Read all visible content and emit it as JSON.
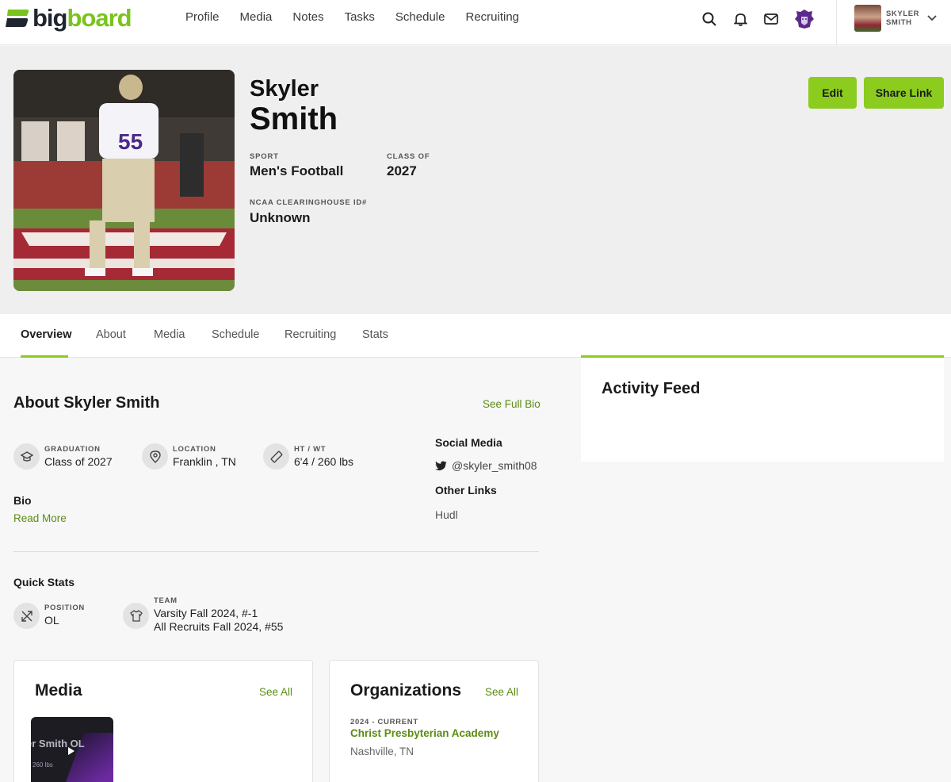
{
  "brand": {
    "logo_part1": "big",
    "logo_part2": "board",
    "accent": "#8bcc1f",
    "logo_icon": "bigboard-logo-mark"
  },
  "nav": {
    "links": [
      "Profile",
      "Media",
      "Notes",
      "Tasks",
      "Schedule",
      "Recruiting"
    ],
    "icons": [
      "search-icon",
      "bell-icon",
      "mail-icon",
      "lion-logo-icon"
    ],
    "user_name_line1": "SKYLER",
    "user_name_line2": "SMITH"
  },
  "profile": {
    "first_name": "Skyler",
    "last_name": "Smith",
    "sport_label": "SPORT",
    "sport": "Men's Football",
    "class_label": "CLASS OF",
    "class_of": "2027",
    "ncaa_label": "NCAA CLEARINGHOUSE ID#",
    "ncaa_id": "Unknown",
    "jersey_number": "55",
    "edit_label": "Edit",
    "share_label": "Share Link"
  },
  "tabs": [
    "Overview",
    "About",
    "Media",
    "Schedule",
    "Recruiting",
    "Stats"
  ],
  "about": {
    "title": "About Skyler Smith",
    "see_full_bio": "See Full Bio",
    "graduation_label": "GRADUATION",
    "graduation": "Class of 2027",
    "location_label": "LOCATION",
    "location": "Franklin , TN",
    "htwt_label": "HT / WT",
    "htwt": "6'4 / 260 lbs",
    "bio_label": "Bio",
    "read_more": "Read More",
    "social_label": "Social Media",
    "twitter": "@skyler_smith08",
    "other_links_label": "Other Links",
    "other_link": "Hudl"
  },
  "quick_stats": {
    "title": "Quick Stats",
    "position_label": "POSITION",
    "position": "OL",
    "team_label": "TEAM",
    "team_line1": "Varsity Fall 2024, #-1",
    "team_line2": "All Recruits Fall 2024, #55"
  },
  "activity_feed": {
    "title": "Activity Feed"
  },
  "media_card": {
    "title": "Media",
    "see_all": "See All",
    "video_text": "er Smith OL",
    "video_sub": "260 lbs"
  },
  "org_card": {
    "title": "Organizations",
    "see_all": "See All",
    "period": "2024 - CURRENT",
    "name": "Christ Presbyterian Academy",
    "location": "Nashville, TN"
  }
}
